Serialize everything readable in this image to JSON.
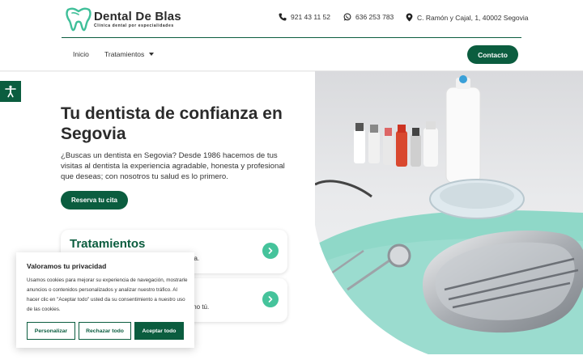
{
  "header": {
    "brand_name": "Dental De Blas",
    "brand_tagline": "Clínica dental por especialidades",
    "phone_landline": "921 43 11 52",
    "phone_whatsapp": "636 253 783",
    "address": "C. Ramón y Cajal, 1, 40002 Segovia"
  },
  "nav": {
    "items": [
      {
        "label": "Inicio"
      },
      {
        "label": "Tratamientos"
      }
    ],
    "contact_label": "Contacto"
  },
  "hero": {
    "title": "Tu dentista de confianza en Segovia",
    "text": "¿Buscas un dentista en Segovia? Desde 1986 hacemos de tus visitas al dentista la experiencia agradable, honesta y profesional que deseas; con nosotros tu salud es lo primero.",
    "cta_label": "Reserva tu cita"
  },
  "cards": [
    {
      "title": "Tratamientos",
      "desc_visible": "na."
    },
    {
      "title": "",
      "desc_visible": "mo tú."
    }
  ],
  "cookie": {
    "title": "Valoramos tu privacidad",
    "text": "Usamos cookies para mejorar su experiencia de navegación, mostrarle anuncios o contenidos personalizados y analizar nuestro tráfico. Al hacer clic en \"Aceptar todo\" usted da su consentimiento a nuestro uso de las cookies.",
    "customize_label": "Personalizar",
    "reject_label": "Rechazar todo",
    "accept_label": "Aceptar todo"
  },
  "icons": {
    "phone": "phone-icon",
    "whatsapp": "whatsapp-icon",
    "location": "location-pin-icon",
    "accessibility": "accessibility-icon",
    "arrow": "chevron-right-icon"
  },
  "colors": {
    "brand_green": "#0b5d3f",
    "accent_mint": "#45c39b"
  }
}
